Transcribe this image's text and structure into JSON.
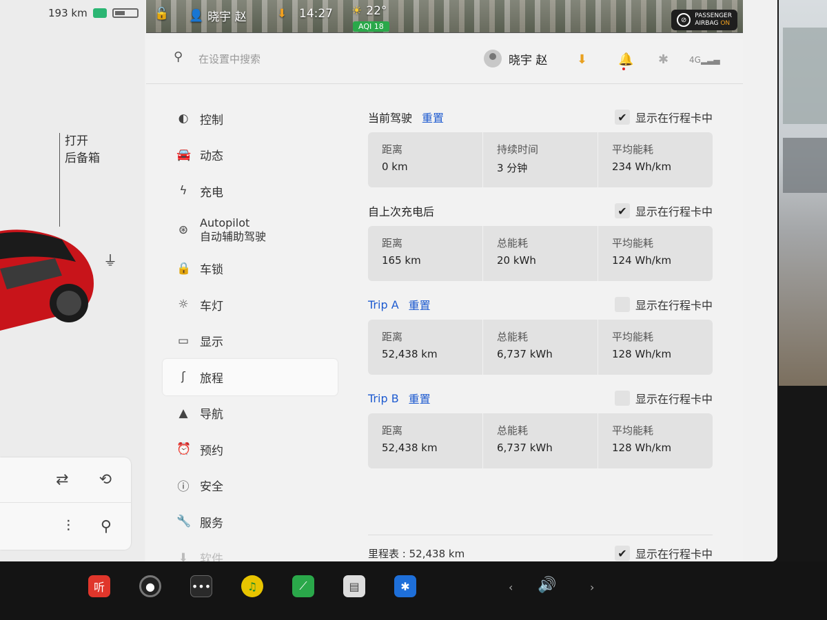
{
  "status": {
    "range": "193 km",
    "driver_name": "晓宇 赵",
    "time": "14:27",
    "temperature": "22°",
    "aqi": "AQI 18",
    "airbag_line1": "PASSENGER",
    "airbag_line2": "AIRBAG",
    "airbag_state": "ON"
  },
  "car_panel": {
    "trunk_label_line1": "打开",
    "trunk_label_line2": "后备箱"
  },
  "header": {
    "search_placeholder": "在设置中搜索",
    "user_name": "晓宇 赵",
    "signal_label": "4G"
  },
  "nav": {
    "items": [
      {
        "label": "控制",
        "icon": "toggle-icon"
      },
      {
        "label": "动态",
        "icon": "car-icon"
      },
      {
        "label": "充电",
        "icon": "bolt-icon"
      },
      {
        "label": "Autopilot",
        "label2": "自动辅助驾驶",
        "icon": "steering-wheel-icon"
      },
      {
        "label": "车锁",
        "icon": "lock-icon"
      },
      {
        "label": "车灯",
        "icon": "light-icon"
      },
      {
        "label": "显示",
        "icon": "display-icon"
      },
      {
        "label": "旅程",
        "icon": "trip-icon",
        "active": true
      },
      {
        "label": "导航",
        "icon": "navigation-icon"
      },
      {
        "label": "预约",
        "icon": "schedule-icon"
      },
      {
        "label": "安全",
        "icon": "safety-icon"
      },
      {
        "label": "服务",
        "icon": "wrench-icon"
      },
      {
        "label": "软件",
        "icon": "download-icon"
      }
    ]
  },
  "trips": {
    "show_label": "显示在行程卡中",
    "reset_label": "重置",
    "current": {
      "title": "当前驾驶",
      "checked": true,
      "stats": [
        {
          "label": "距离",
          "value": "0 km"
        },
        {
          "label": "持续时间",
          "value": "3 分钟"
        },
        {
          "label": "平均能耗",
          "value": "234 Wh/km"
        }
      ]
    },
    "since_charge": {
      "title": "自上次充电后",
      "checked": true,
      "stats": [
        {
          "label": "距离",
          "value": "165 km"
        },
        {
          "label": "总能耗",
          "value": "20 kWh"
        },
        {
          "label": "平均能耗",
          "value": "124 Wh/km"
        }
      ]
    },
    "trip_a": {
      "title": "Trip A",
      "checked": false,
      "stats": [
        {
          "label": "距离",
          "value": "52,438 km"
        },
        {
          "label": "总能耗",
          "value": "6,737 kWh"
        },
        {
          "label": "平均能耗",
          "value": "128 Wh/km"
        }
      ]
    },
    "trip_b": {
      "title": "Trip B",
      "checked": false,
      "stats": [
        {
          "label": "距离",
          "value": "52,438 km"
        },
        {
          "label": "总能耗",
          "value": "6,737 kWh"
        },
        {
          "label": "平均能耗",
          "value": "128 Wh/km"
        }
      ]
    },
    "odometer": {
      "label": "里程表",
      "value": "52,438 km",
      "checked": true
    }
  },
  "dock": {
    "music_app_label": "听"
  },
  "colors": {
    "accent_blue": "#1e5bd0",
    "download_orange": "#e8a020",
    "aqi_green": "#2aa84a"
  }
}
